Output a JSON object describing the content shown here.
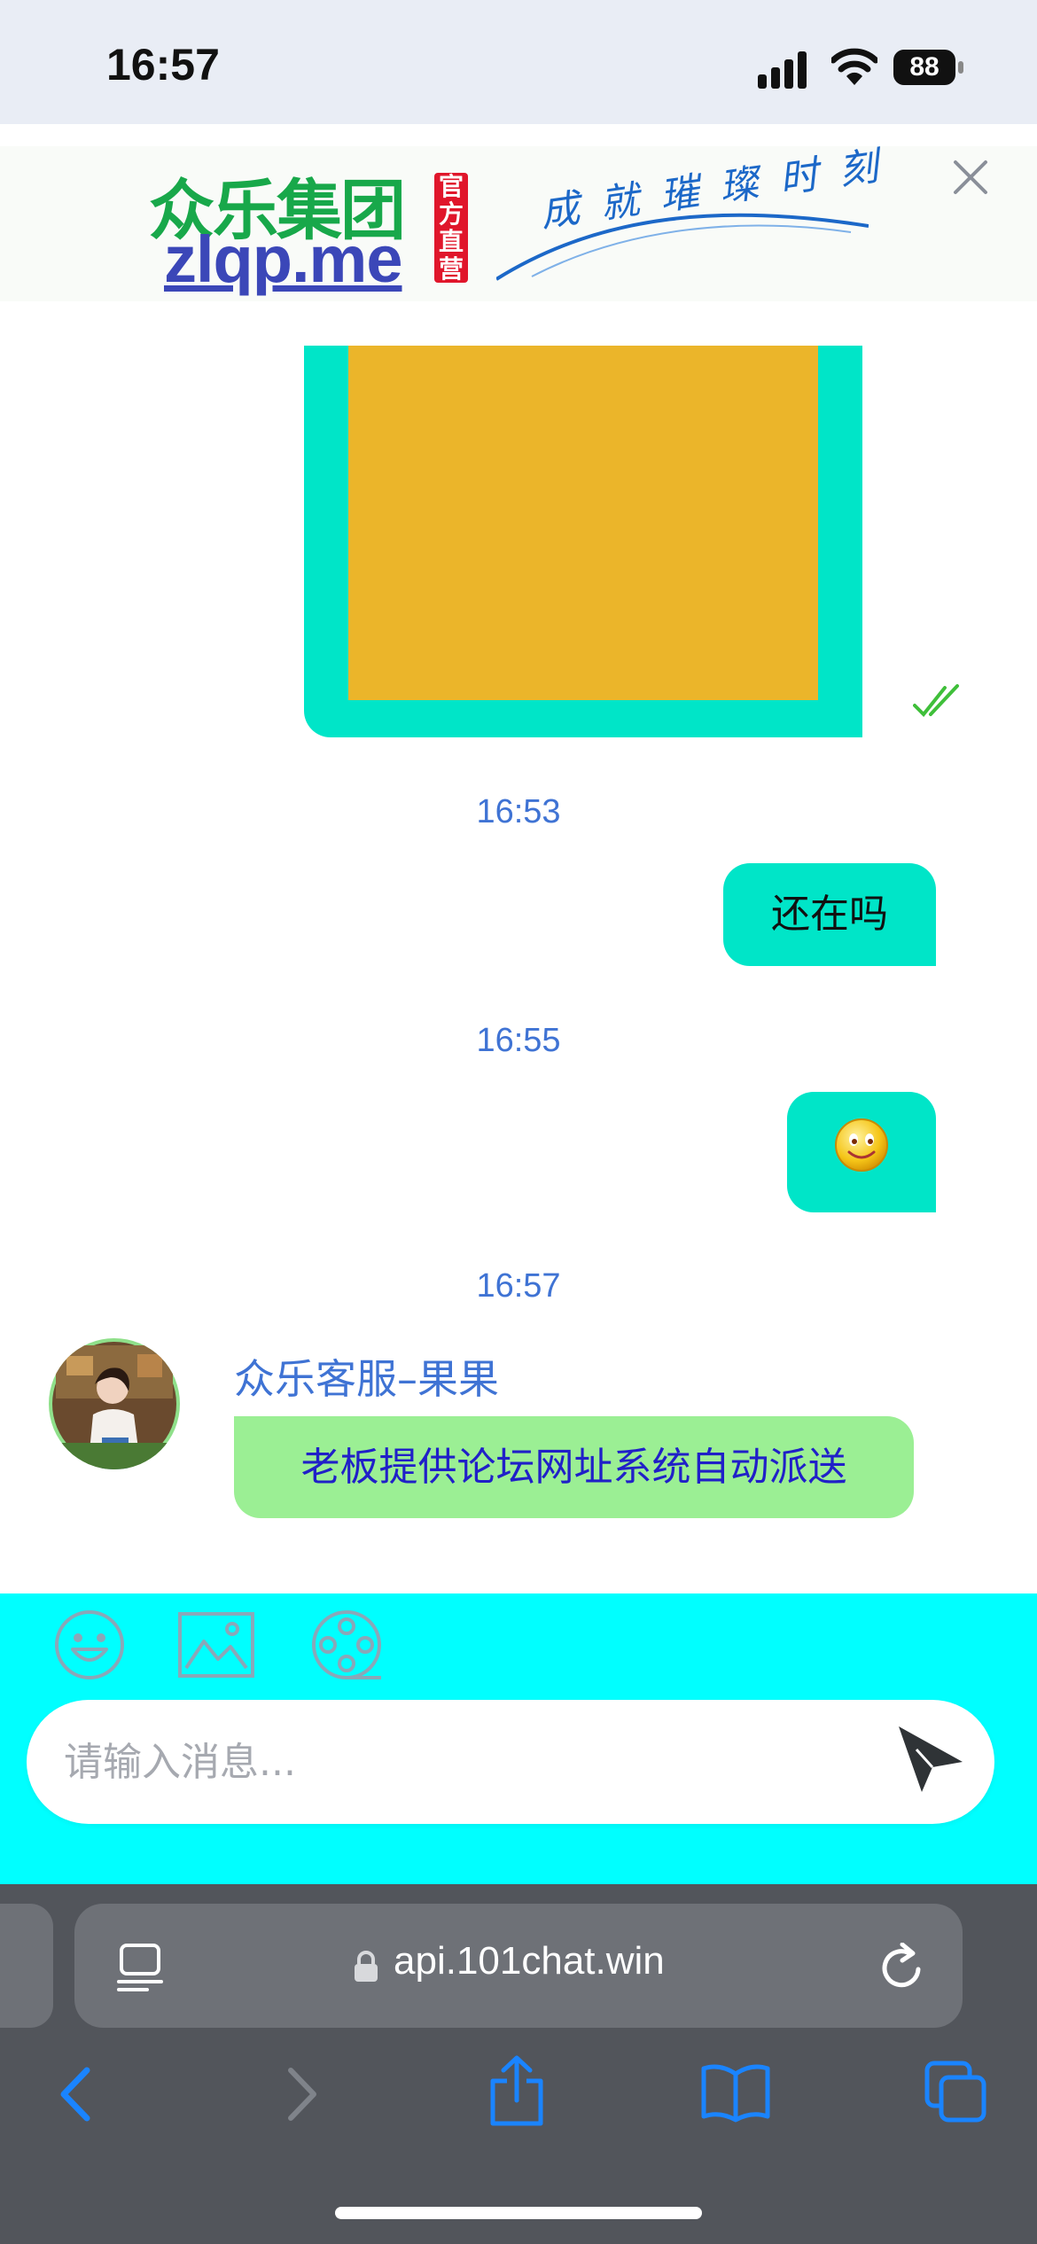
{
  "status_bar": {
    "time": "16:57",
    "battery": "88"
  },
  "banner": {
    "logo_cn": "众乐集团",
    "logo_en": "zlqp.me",
    "badge": "官方直营",
    "slogan": "成就璀璨时刻"
  },
  "chat": {
    "messages": [
      {
        "timestamp": "16:53",
        "text": "还在吗"
      },
      {
        "timestamp": "16:55",
        "text": ""
      },
      {
        "timestamp": "16:57",
        "sender": "众乐客服–果果",
        "text": "老板提供论坛网址系统自动派送"
      }
    ]
  },
  "input": {
    "placeholder": "请输入消息..."
  },
  "browser": {
    "url": "api.101chat.win"
  },
  "colors": {
    "outgoing_bubble": "#00e5c8",
    "incoming_bubble": "#9bef94",
    "input_panel": "#00ffff",
    "timestamp": "#3f73d4",
    "image_fill": "#ebb52a"
  }
}
